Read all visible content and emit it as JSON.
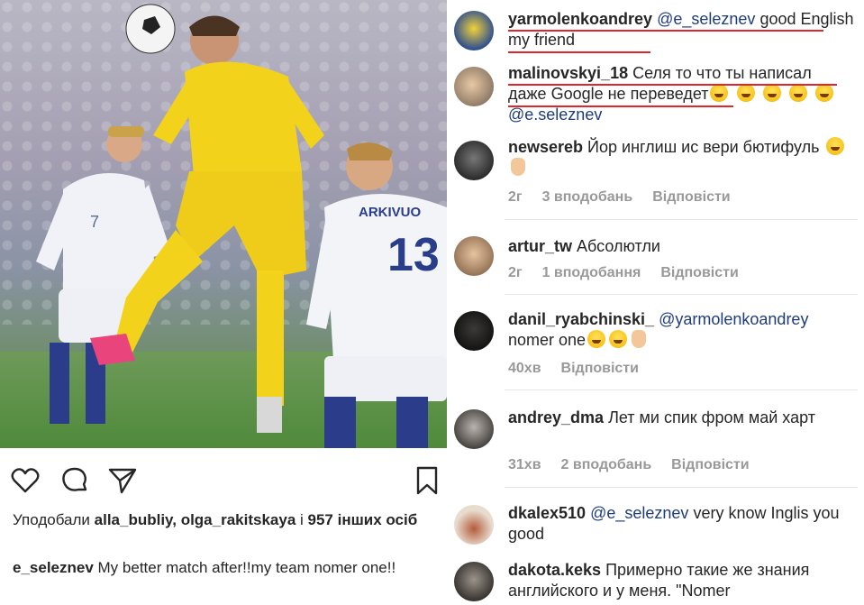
{
  "post": {
    "icons": [
      "heart-icon",
      "comment-icon",
      "share-icon",
      "bookmark-icon"
    ],
    "likes_prefix": "Уподобали ",
    "likes_users": "alla_bubliy, olga_rakitskaya",
    "likes_mid": " і ",
    "likes_count": "957 інших осіб",
    "caption_user": "e_seleznev",
    "caption_text": " My better match after!!my team nomer one!!",
    "photo_jersey_number": "13",
    "photo_jersey_name": "ARKIVUO"
  },
  "comments": [
    {
      "user": "yarmolenkoandrey",
      "mention": "@e_seleznev",
      "text": " good English my friend",
      "time": "",
      "likes": "",
      "reply": ""
    },
    {
      "user": "malinovskyi_18",
      "mention": "",
      "text": " Селя то что ты написал даже Google не переведет",
      "mention2": "@e.seleznev",
      "time": "",
      "likes": "",
      "reply": ""
    },
    {
      "user": "newsereb",
      "mention": "",
      "text": " Йор инглиш ис вери бютифуль",
      "time": "2г",
      "likes": "3 вподобань",
      "reply": "Відповісти"
    },
    {
      "user": "artur_tw",
      "mention": "",
      "text": " Абсолютли",
      "time": "2г",
      "likes": "1 вподобання",
      "reply": "Відповісти"
    },
    {
      "user": "danil_ryabchinski_",
      "mention": "@yarmolenkoandrey",
      "text": "nomer one",
      "time": "40хв",
      "likes": "",
      "reply": "Відповісти"
    },
    {
      "user": "andrey_dma",
      "mention": "",
      "text": " Лет ми спик фром май харт",
      "time": "31хв",
      "likes": "2 вподобань",
      "reply": "Відповісти"
    },
    {
      "user": "dkalex510",
      "mention": "@e_seleznev",
      "text": " very know Inglis you good",
      "time": "",
      "likes": "",
      "reply": ""
    },
    {
      "user": "dakota.keks",
      "mention": "",
      "text": " Примерно такие же знания английского и у меня. \"Nomer",
      "time": "",
      "likes": "",
      "reply": ""
    }
  ],
  "colors": {
    "highlight": "#e0262b",
    "mention": "#1f3c7a",
    "meta": "#999999",
    "ukraine_kit": "#f3d21c",
    "finland_kit": "#f2f4f8"
  }
}
